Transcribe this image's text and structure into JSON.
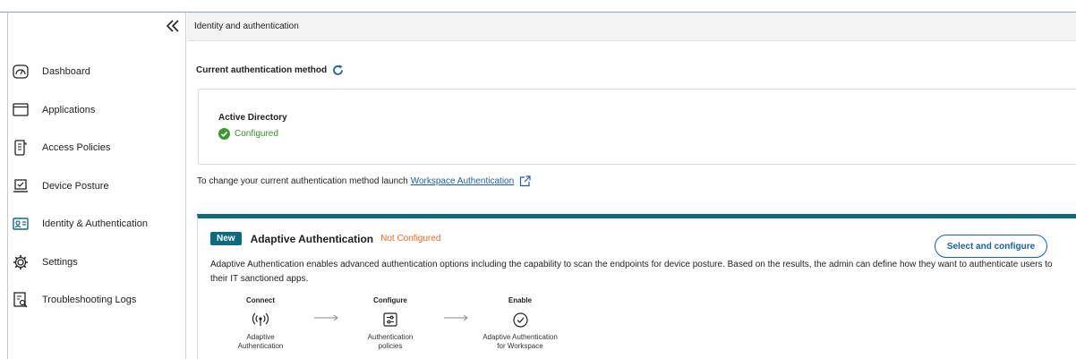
{
  "colors": {
    "accent": "#0e6b7d",
    "link": "#1a5fa8",
    "success": "#3a8a2a",
    "warning": "#e86a1d"
  },
  "sidebar": {
    "collapse_icon": "double-chevron-left-icon",
    "items": [
      {
        "label": "Dashboard",
        "icon": "gauge-icon"
      },
      {
        "label": "Applications",
        "icon": "window-icon"
      },
      {
        "label": "Access Policies",
        "icon": "scroll-icon"
      },
      {
        "label": "Device Posture",
        "icon": "laptop-check-icon"
      },
      {
        "label": "Identity & Authentication",
        "icon": "id-card-icon"
      },
      {
        "label": "Settings",
        "icon": "gear-icon"
      },
      {
        "label": "Troubleshooting Logs",
        "icon": "log-search-icon"
      }
    ]
  },
  "header": {
    "breadcrumb": "Identity and authentication"
  },
  "current": {
    "title": "Current authentication method",
    "refresh_icon": "refresh-icon",
    "method_name": "Active Directory",
    "status": "Configured"
  },
  "change": {
    "text": "To change your current authentication method launch",
    "link": "Workspace Authentication"
  },
  "adaptive": {
    "badge": "New",
    "title": "Adaptive Authentication",
    "status": "Not Configured",
    "button": "Select and configure",
    "description": "Adaptive Authentication enables advanced authentication options including the capability to scan the endpoints for device posture. Based on the results, the admin can define how they want to authenticate users to their IT sanctioned apps.",
    "steps": [
      {
        "title": "Connect",
        "icon": "broadcast-icon",
        "label_1": "Adaptive",
        "label_2": "Authentication"
      },
      {
        "title": "Configure",
        "icon": "sliders-icon",
        "label_1": "Authentication",
        "label_2": "policies"
      },
      {
        "title": "Enable",
        "icon": "check-circle-icon",
        "label_1": "Adaptive Authentication",
        "label_2": "for Workspace"
      }
    ]
  }
}
